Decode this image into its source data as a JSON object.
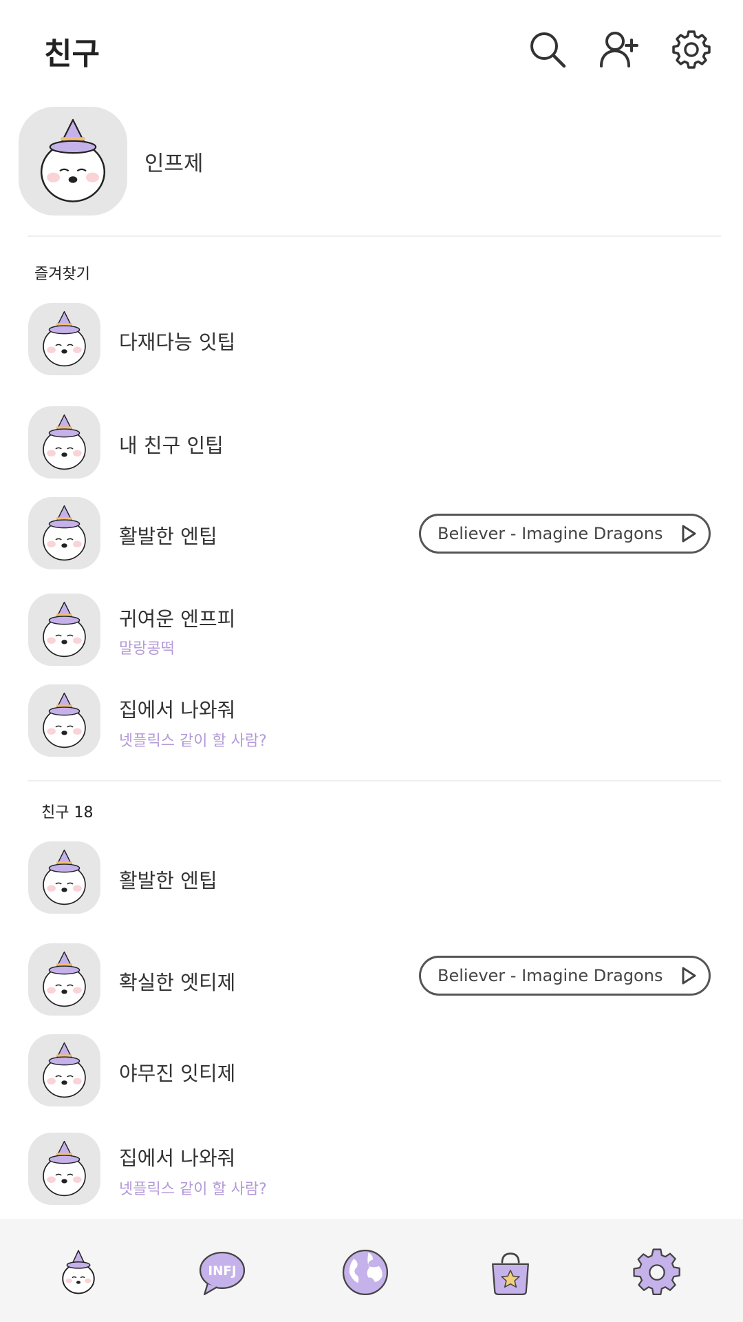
{
  "header": {
    "title": "친구",
    "icons": [
      "search-icon",
      "add-friend-icon",
      "settings-icon"
    ]
  },
  "profile": {
    "name": "인프제"
  },
  "favorites": {
    "label": "즐겨찾기",
    "items": [
      {
        "name": "다재다능 잇팁",
        "status": "",
        "music": ""
      },
      {
        "name": "내 친구 인팁",
        "status": "",
        "music": ""
      },
      {
        "name": "활발한 엔팁",
        "status": "",
        "music": "Believer - Imagine Dragons"
      },
      {
        "name": "귀여운 엔프피",
        "status": "말랑콩떡",
        "music": ""
      },
      {
        "name": "집에서 나와줘",
        "status": "넷플릭스 같이 할 사람?",
        "music": ""
      }
    ]
  },
  "friends": {
    "label": "친구 18",
    "items": [
      {
        "name": "활발한 엔팁",
        "status": "",
        "music": ""
      },
      {
        "name": "확실한 엣티제",
        "status": "",
        "music": "Believer - Imagine Dragons"
      },
      {
        "name": "야무진 잇티제",
        "status": "",
        "music": ""
      },
      {
        "name": "집에서 나와줘",
        "status": "넷플릭스 같이 할 사람?",
        "music": ""
      }
    ]
  },
  "bottom_nav": {
    "chat_badge": "INFJ",
    "items": [
      "friends-tab-icon",
      "chat-tab-icon",
      "globe-tab-icon",
      "shop-tab-icon",
      "settings-tab-icon"
    ]
  },
  "colors": {
    "accent": "#b39ad8",
    "hat": "#c6b2ea",
    "cheek": "#f9d3d6",
    "avatar_bg": "#e6e6e6",
    "nav_bg": "#f5f5f5"
  }
}
